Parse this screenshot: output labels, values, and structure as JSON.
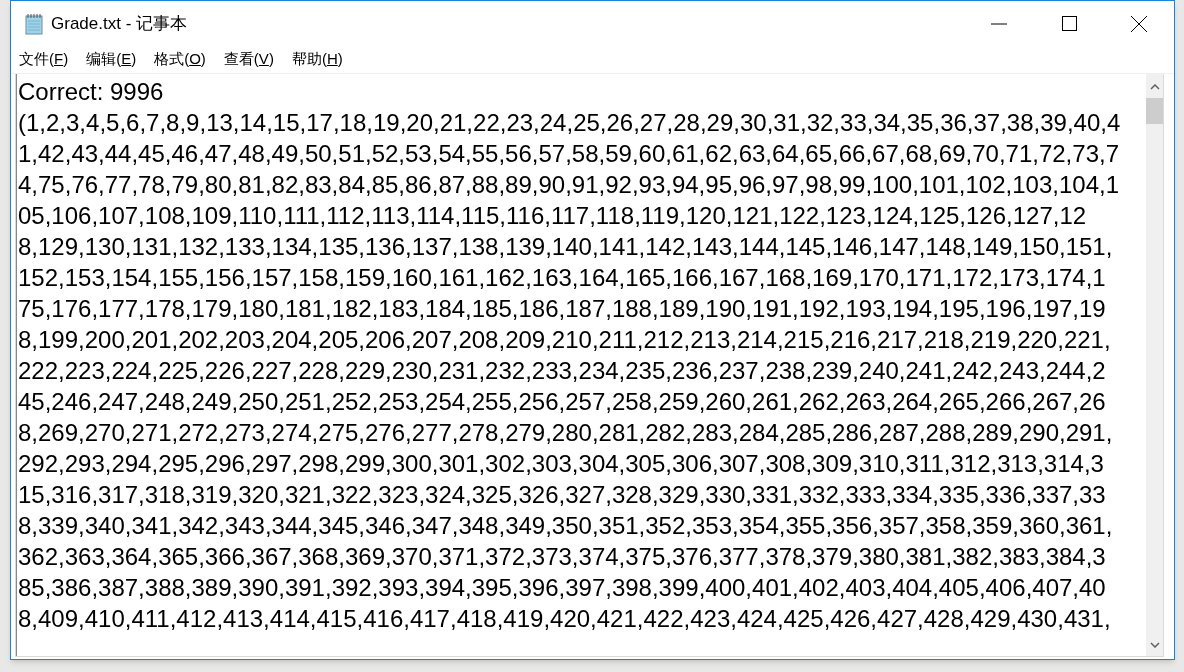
{
  "window": {
    "title": "Grade.txt - 记事本"
  },
  "menu": [
    {
      "label": "文件(",
      "key": "F",
      "end": ")"
    },
    {
      "label": "编辑(",
      "key": "E",
      "end": ")"
    },
    {
      "label": "格式(",
      "key": "O",
      "end": ")"
    },
    {
      "label": "查看(",
      "key": "V",
      "end": ")"
    },
    {
      "label": "帮助(",
      "key": "H",
      "end": ")"
    }
  ],
  "editor": {
    "lines": [
      "Correct: 9996",
      "(1,2,3,4,5,6,7,8,9,13,14,15,17,18,19,20,21,22,23,24,25,26,27,28,29,30,31,32,33,34,35,36,37,38,39,40,4",
      "1,42,43,44,45,46,47,48,49,50,51,52,53,54,55,56,57,58,59,60,61,62,63,64,65,66,67,68,69,70,71,72,73,7",
      "4,75,76,77,78,79,80,81,82,83,84,85,86,87,88,89,90,91,92,93,94,95,96,97,98,99,100,101,102,103,104,1",
      "05,106,107,108,109,110,111,112,113,114,115,116,117,118,119,120,121,122,123,124,125,126,127,12",
      "8,129,130,131,132,133,134,135,136,137,138,139,140,141,142,143,144,145,146,147,148,149,150,151,",
      "152,153,154,155,156,157,158,159,160,161,162,163,164,165,166,167,168,169,170,171,172,173,174,1",
      "75,176,177,178,179,180,181,182,183,184,185,186,187,188,189,190,191,192,193,194,195,196,197,19",
      "8,199,200,201,202,203,204,205,206,207,208,209,210,211,212,213,214,215,216,217,218,219,220,221,",
      "222,223,224,225,226,227,228,229,230,231,232,233,234,235,236,237,238,239,240,241,242,243,244,2",
      "45,246,247,248,249,250,251,252,253,254,255,256,257,258,259,260,261,262,263,264,265,266,267,26",
      "8,269,270,271,272,273,274,275,276,277,278,279,280,281,282,283,284,285,286,287,288,289,290,291,",
      "292,293,294,295,296,297,298,299,300,301,302,303,304,305,306,307,308,309,310,311,312,313,314,3",
      "15,316,317,318,319,320,321,322,323,324,325,326,327,328,329,330,331,332,333,334,335,336,337,33",
      "8,339,340,341,342,343,344,345,346,347,348,349,350,351,352,353,354,355,356,357,358,359,360,361,",
      "362,363,364,365,366,367,368,369,370,371,372,373,374,375,376,377,378,379,380,381,382,383,384,3",
      "85,386,387,388,389,390,391,392,393,394,395,396,397,398,399,400,401,402,403,404,405,406,407,40",
      "8,409,410,411,412,413,414,415,416,417,418,419,420,421,422,423,424,425,426,427,428,429,430,431,"
    ]
  }
}
